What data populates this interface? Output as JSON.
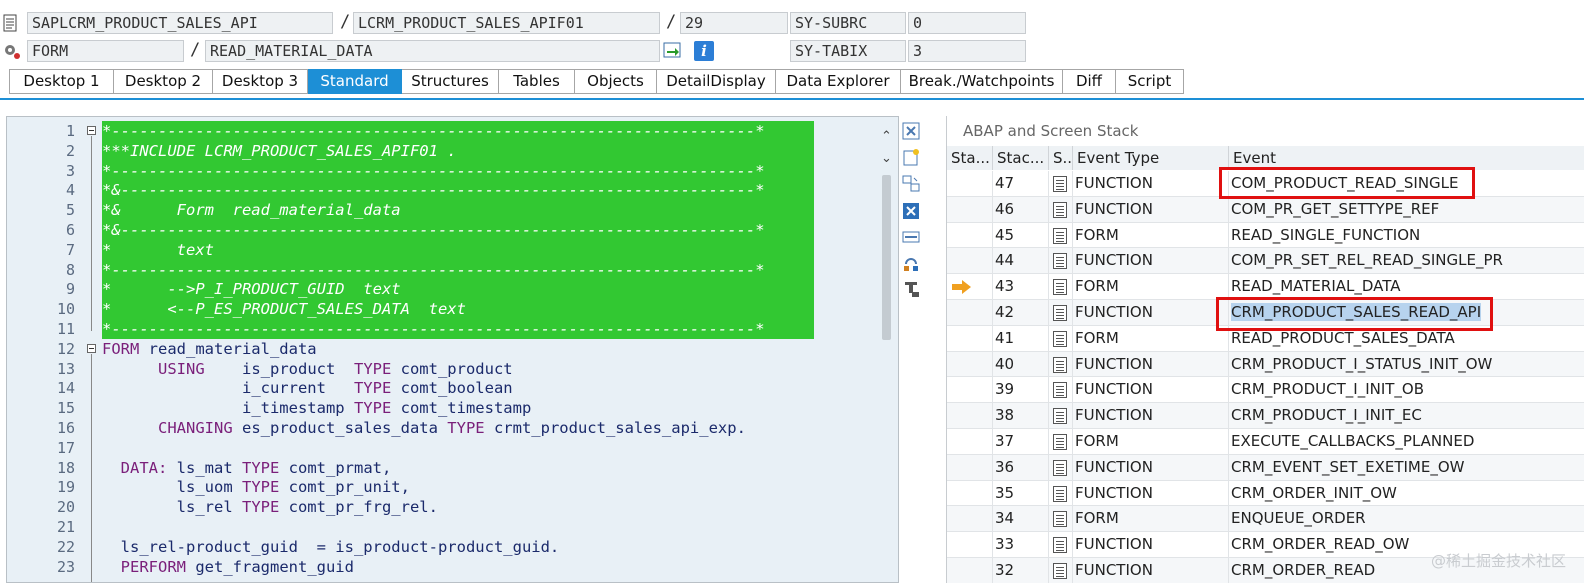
{
  "header": {
    "program": "SAPLCRM_PRODUCT_SALES_API",
    "include": "LCRM_PRODUCT_SALES_APIF01",
    "line": "29",
    "sy_subrc_label": "SY-SUBRC",
    "sy_subrc_value": "0",
    "event_type": "FORM",
    "event_name": "READ_MATERIAL_DATA",
    "sy_tabix_label": "SY-TABIX",
    "sy_tabix_value": "3",
    "separator": "/",
    "info_icon": "i"
  },
  "tabs": [
    {
      "label": "Desktop 1",
      "active": false
    },
    {
      "label": "Desktop 2",
      "active": false
    },
    {
      "label": "Desktop 3",
      "active": false
    },
    {
      "label": "Standard",
      "active": true
    },
    {
      "label": "Structures",
      "active": false
    },
    {
      "label": "Tables",
      "active": false
    },
    {
      "label": "Objects",
      "active": false
    },
    {
      "label": "DetailDisplay",
      "active": false
    },
    {
      "label": "Data Explorer",
      "active": false
    },
    {
      "label": "Break./Watchpoints",
      "active": false
    },
    {
      "label": "Diff",
      "active": false
    },
    {
      "label": "Script",
      "active": false
    }
  ],
  "code": [
    {
      "n": "1",
      "text": "*---------------------------------------------------------------------*",
      "comment": true
    },
    {
      "n": "2",
      "text": "***INCLUDE LCRM_PRODUCT_SALES_APIF01 .",
      "comment": true
    },
    {
      "n": "3",
      "text": "*---------------------------------------------------------------------*",
      "comment": true
    },
    {
      "n": "4",
      "text": "*&--------------------------------------------------------------------*",
      "comment": true
    },
    {
      "n": "5",
      "text": "*&      Form  read_material_data",
      "comment": true
    },
    {
      "n": "6",
      "text": "*&--------------------------------------------------------------------*",
      "comment": true
    },
    {
      "n": "7",
      "text": "*       text",
      "comment": true
    },
    {
      "n": "8",
      "text": "*---------------------------------------------------------------------*",
      "comment": true
    },
    {
      "n": "9",
      "text": "*      -->P_I_PRODUCT_GUID  text",
      "comment": true
    },
    {
      "n": "10",
      "text": "*      <--P_ES_PRODUCT_SALES_DATA  text",
      "comment": true
    },
    {
      "n": "11",
      "text": "*---------------------------------------------------------------------*",
      "comment": true
    },
    {
      "n": "12",
      "kw": "FORM",
      "text": " read_material_data",
      "comment": false
    },
    {
      "n": "13",
      "indent": "      ",
      "kw": "USING",
      "text": "    is_product  ",
      "kw2": "TYPE",
      "text2": " comt_product",
      "comment": false
    },
    {
      "n": "14",
      "indent": "               ",
      "kw": "",
      "text": "i_current   ",
      "kw2": "TYPE",
      "text2": " comt_boolean",
      "comment": false
    },
    {
      "n": "15",
      "indent": "               ",
      "kw": "",
      "text": "i_timestamp ",
      "kw2": "TYPE",
      "text2": " comt_timestamp",
      "comment": false
    },
    {
      "n": "16",
      "indent": "      ",
      "kw": "CHANGING",
      "text": " es_product_sales_data ",
      "kw2": "TYPE",
      "text2": " crmt_product_sales_api_exp.",
      "comment": false
    },
    {
      "n": "17",
      "text": "",
      "comment": false
    },
    {
      "n": "18",
      "indent": "  ",
      "kw": "DATA:",
      "text": " ls_mat ",
      "kw2": "TYPE",
      "text2": " comt_prmat,",
      "comment": false
    },
    {
      "n": "19",
      "indent": "        ",
      "kw": "",
      "text": "ls_uom ",
      "kw2": "TYPE",
      "text2": " comt_pr_unit,",
      "comment": false
    },
    {
      "n": "20",
      "indent": "        ",
      "kw": "",
      "text": "ls_rel ",
      "kw2": "TYPE",
      "text2": " comt_pr_frg_rel.",
      "comment": false
    },
    {
      "n": "21",
      "text": "",
      "comment": false
    },
    {
      "n": "22",
      "indent": "  ",
      "kw": "",
      "text": "ls_rel-product_guid  = is_product-product_guid.",
      "comment": false
    },
    {
      "n": "23",
      "indent": "  ",
      "kw": "PERFORM",
      "text": " get_fragment_guid",
      "comment": false
    }
  ],
  "stack": {
    "title": "ABAP and Screen Stack",
    "columns": [
      "Sta...",
      "Stac...",
      "S...",
      "Event Type",
      "Event"
    ],
    "current_marker_row": 43,
    "rows": [
      {
        "level": "47",
        "type": "FUNCTION",
        "event": "COM_PRODUCT_READ_SINGLE",
        "boxed": true
      },
      {
        "level": "46",
        "type": "FUNCTION",
        "event": "COM_PR_GET_SETTYPE_REF"
      },
      {
        "level": "45",
        "type": "FORM",
        "event": "READ_SINGLE_FUNCTION"
      },
      {
        "level": "44",
        "type": "FUNCTION",
        "event": "COM_PR_SET_REL_READ_SINGLE_PR"
      },
      {
        "level": "43",
        "type": "FORM",
        "event": "READ_MATERIAL_DATA",
        "current": true
      },
      {
        "level": "42",
        "type": "FUNCTION",
        "event": "CRM_PRODUCT_SALES_READ_API",
        "boxed": true,
        "selected": true
      },
      {
        "level": "41",
        "type": "FORM",
        "event": "READ_PRODUCT_SALES_DATA"
      },
      {
        "level": "40",
        "type": "FUNCTION",
        "event": "CRM_PRODUCT_I_STATUS_INIT_OW"
      },
      {
        "level": "39",
        "type": "FUNCTION",
        "event": "CRM_PRODUCT_I_INIT_OB"
      },
      {
        "level": "38",
        "type": "FUNCTION",
        "event": "CRM_PRODUCT_I_INIT_EC"
      },
      {
        "level": "37",
        "type": "FORM",
        "event": "EXECUTE_CALLBACKS_PLANNED"
      },
      {
        "level": "36",
        "type": "FUNCTION",
        "event": "CRM_EVENT_SET_EXETIME_OW"
      },
      {
        "level": "35",
        "type": "FUNCTION",
        "event": "CRM_ORDER_INIT_OW"
      },
      {
        "level": "34",
        "type": "FORM",
        "event": "ENQUEUE_ORDER"
      },
      {
        "level": "33",
        "type": "FUNCTION",
        "event": "CRM_ORDER_READ_OW"
      },
      {
        "level": "32",
        "type": "FUNCTION",
        "event": "CRM_ORDER_READ"
      }
    ]
  },
  "watermark": "@稀土掘金技术社区",
  "colors": {
    "accent": "#1d8fd6",
    "comment_highlight": "#32c832",
    "marker": "#f0a020",
    "annotation_box": "#e01010"
  }
}
